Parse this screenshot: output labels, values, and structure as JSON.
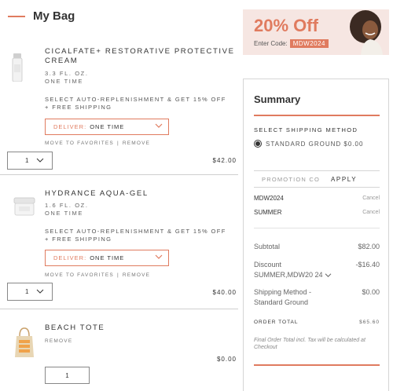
{
  "bag": {
    "title": "My Bag"
  },
  "promo_banner": {
    "headline": "20% Off",
    "code_label": "Enter Code:",
    "code": "MDW2024"
  },
  "products": [
    {
      "name_line1": "CICALFATE+ RESTORATIVE PROTECTIVE",
      "name_line2": "CREAM",
      "size": "3.3 FL. OZ.",
      "frequency": "ONE TIME",
      "replenish_line1": "SELECT AUTO-REPLENISHMENT & GET 15% OFF",
      "replenish_line2": "+ FREE SHIPPING",
      "deliver_label": "DELIVER:",
      "deliver_value": "ONE TIME",
      "move_to_favorites": "MOVE TO FAVORITES",
      "separator": "|",
      "remove": "REMOVE",
      "qty": "1",
      "price": "$42.00"
    },
    {
      "name_line1": "HYDRANCE AQUA-GEL",
      "size": "1.6 FL. OZ.",
      "frequency": "ONE TIME",
      "replenish_line1": "SELECT AUTO-REPLENISHMENT & GET 15% OFF",
      "replenish_line2": "+ FREE SHIPPING",
      "deliver_label": "DELIVER:",
      "deliver_value": "ONE TIME",
      "move_to_favorites": "MOVE TO FAVORITES",
      "separator": "|",
      "remove": "REMOVE",
      "qty": "1",
      "price": "$40.00"
    },
    {
      "name_line1": "BEACH TOTE",
      "remove": "REMOVE",
      "qty": "1",
      "price": "$0.00"
    }
  ],
  "summary": {
    "title": "Summary",
    "shipping_label": "SELECT SHIPPING METHOD",
    "shipping_option": "STANDARD GROUND $0.00",
    "promo_placeholder": "PROMOTION CO",
    "apply": "APPLY",
    "codes": [
      {
        "code": "MDW2024",
        "cancel": "Cancel"
      },
      {
        "code": "SUMMER",
        "cancel": "Cancel"
      }
    ],
    "subtotal_label": "Subtotal",
    "subtotal_value": "$82.00",
    "discount_label": "Discount SUMMER,MDW20 24",
    "discount_value": "-$16.40",
    "shipping_method_label": "Shipping Method - Standard Ground",
    "shipping_method_value": "$0.00",
    "order_total_label": "ORDER TOTAL",
    "order_total_value": "$65.60",
    "note": "Final Order Total incl. Tax will be calculated at Checkout"
  },
  "colors": {
    "accent": "#e07b5f",
    "promo_bg": "#f6e6e2"
  },
  "icons": {
    "qty_dropdown": "chevron-down-icon",
    "deliver_dropdown": "chevron-down-icon",
    "discount_toggle": "chevron-down-icon"
  }
}
